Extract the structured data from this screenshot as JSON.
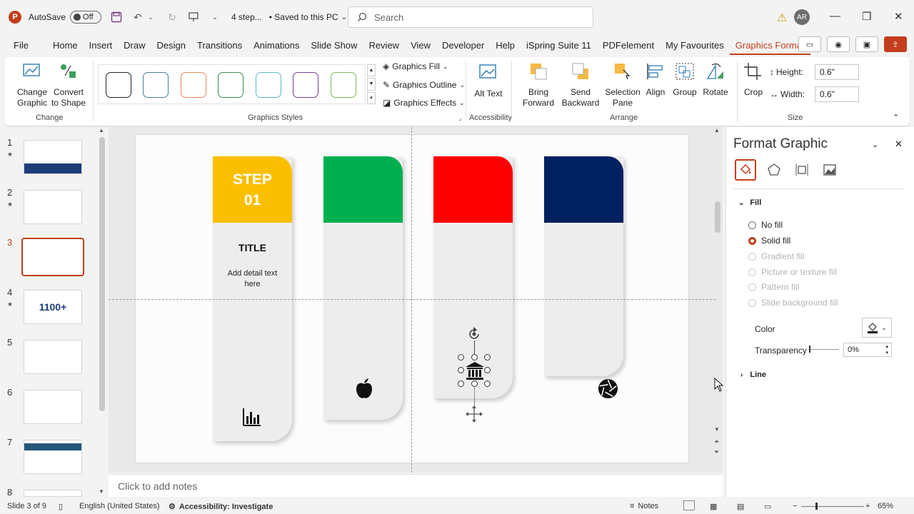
{
  "titlebar": {
    "app_initial": "P",
    "autosave_label": "AutoSave",
    "autosave_state": "Off",
    "filename": "4 step...",
    "saved_status": "• Saved to this PC",
    "search_placeholder": "Search",
    "user_initials": "AR"
  },
  "menu": {
    "tabs": [
      "File",
      "Home",
      "Insert",
      "Draw",
      "Design",
      "Transitions",
      "Animations",
      "Slide Show",
      "Review",
      "View",
      "Developer",
      "Help",
      "iSpring Suite 11",
      "PDFelement",
      "My Favourites",
      "Graphics Format"
    ],
    "active": "Graphics Format"
  },
  "ribbon": {
    "change_graphic": "Change Graphic",
    "convert_to_shape": "Convert to Shape",
    "group_change": "Change",
    "group_styles": "Graphics Styles",
    "style_colors": [
      "#222222",
      "#4a7d9c",
      "#e8875a",
      "#3d8a52",
      "#5bb6c8",
      "#7a3b8c",
      "#7bb861"
    ],
    "graphics_fill": "Graphics Fill",
    "graphics_outline": "Graphics Outline",
    "graphics_effects": "Graphics Effects",
    "alt_text": "Alt Text",
    "group_accessibility": "Accessibility",
    "bring_forward": "Bring Forward",
    "send_backward": "Send Backward",
    "selection_pane": "Selection Pane",
    "align": "Align",
    "group": "Group",
    "rotate": "Rotate",
    "group_arrange": "Arrange",
    "crop": "Crop",
    "height_label": "Height:",
    "height_value": "0.6\"",
    "width_label": "Width:",
    "width_value": "0.6\"",
    "group_size": "Size"
  },
  "thumbnails": {
    "numbers": [
      "1",
      "2",
      "3",
      "4",
      "5",
      "6",
      "7",
      "8"
    ],
    "selected": "3",
    "thumb4_text": "1100+"
  },
  "slide": {
    "cards": [
      {
        "color": "#fbbf00",
        "step": "STEP",
        "step_num": "01",
        "title": "TITLE",
        "detail": "Add detail text here",
        "icon": "bar-chart-icon"
      },
      {
        "color": "#00b050",
        "icon": "apple-icon"
      },
      {
        "color": "#ff0000",
        "icon": "bank-icon"
      },
      {
        "color": "#002060",
        "icon": "aperture-icon"
      }
    ]
  },
  "notes_placeholder": "Click to add notes",
  "format_panel": {
    "title": "Format Graphic",
    "section_fill": "Fill",
    "options": [
      "No fill",
      "Solid fill",
      "Gradient fill",
      "Picture or texture fill",
      "Pattern fill",
      "Slide background fill"
    ],
    "selected_option": "Solid fill",
    "color_label": "Color",
    "transparency_label": "Transparency",
    "transparency_value": "0%",
    "section_line": "Line"
  },
  "statusbar": {
    "slide_info": "Slide 3 of 9",
    "language": "English (United States)",
    "accessibility": "Accessibility: Investigate",
    "notes": "Notes",
    "zoom": "65%"
  }
}
